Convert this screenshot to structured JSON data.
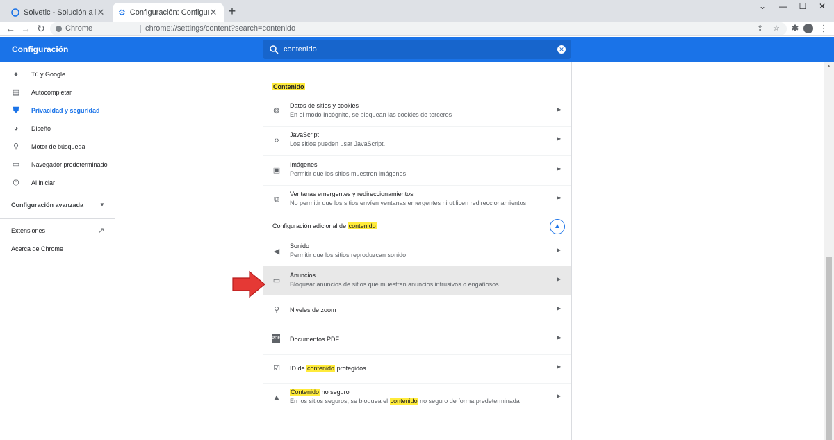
{
  "tabs": [
    {
      "title": "Solvetic - Solución a los problem",
      "active": false
    },
    {
      "title": "Configuración: Configuración de",
      "active": true
    }
  ],
  "toolbar": {
    "chip_label": "Chrome",
    "url": "chrome://settings/content?search=contenido"
  },
  "header": {
    "title": "Configuración",
    "search_value": "contenido"
  },
  "sidebar": {
    "items": [
      {
        "label": "Tú y Google",
        "icon": "person-icon"
      },
      {
        "label": "Autocompletar",
        "icon": "clipboard-icon"
      },
      {
        "label": "Privacidad y seguridad",
        "icon": "shield-icon",
        "selected": true
      },
      {
        "label": "Diseño",
        "icon": "palette-icon"
      },
      {
        "label": "Motor de búsqueda",
        "icon": "search-icon"
      },
      {
        "label": "Navegador predeterminado",
        "icon": "browser-icon"
      },
      {
        "label": "Al iniciar",
        "icon": "power-icon"
      }
    ],
    "advanced": "Configuración avanzada",
    "extensions": "Extensiones",
    "about": "Acerca de Chrome"
  },
  "content": {
    "section_title": "Contenido",
    "rows": [
      {
        "title": "Datos de sitios y cookies",
        "sub": "En el modo Incógnito, se bloquean las cookies de terceros",
        "icon": "cookie-icon"
      },
      {
        "title": "JavaScript",
        "sub": "Los sitios pueden usar JavaScript.",
        "icon": "code-icon"
      },
      {
        "title": "Imágenes",
        "sub": "Permitir que los sitios muestren imágenes",
        "icon": "image-icon"
      },
      {
        "title": "Ventanas emergentes y redireccionamientos",
        "sub": "No permitir que los sitios envíen ventanas emergentes ni utilicen redireccionamientos",
        "icon": "popup-icon"
      }
    ],
    "advanced_label_prefix": "Configuración adicional de",
    "advanced_label_highlight": "contenido",
    "advanced_rows": [
      {
        "title": "Sonido",
        "sub": "Permitir que los sitios reproduzcan sonido",
        "icon": "speaker-icon"
      },
      {
        "title": "Anuncios",
        "sub": "Bloquear anuncios de sitios que muestran anuncios intrusivos o engañosos",
        "icon": "ads-icon",
        "highlighted": true
      },
      {
        "title": "Niveles de zoom",
        "icon": "zoom-icon"
      },
      {
        "title": "Documentos PDF",
        "icon": "pdf-icon"
      }
    ],
    "protected_id": {
      "prefix": "ID de",
      "highlight": "contenido",
      "suffix": "protegidos",
      "icon": "protected-icon"
    },
    "insecure": {
      "title_highlight": "Contenido",
      "title_suffix": "no seguro",
      "sub_prefix": "En los sitios seguros, se bloquea el",
      "sub_highlight": "contenido",
      "sub_suffix": "no seguro de forma predeterminada",
      "icon": "warning-icon"
    }
  },
  "colors": {
    "accent": "#1a73e8",
    "highlight": "#ffeb3b",
    "annotation": "#e53935"
  }
}
